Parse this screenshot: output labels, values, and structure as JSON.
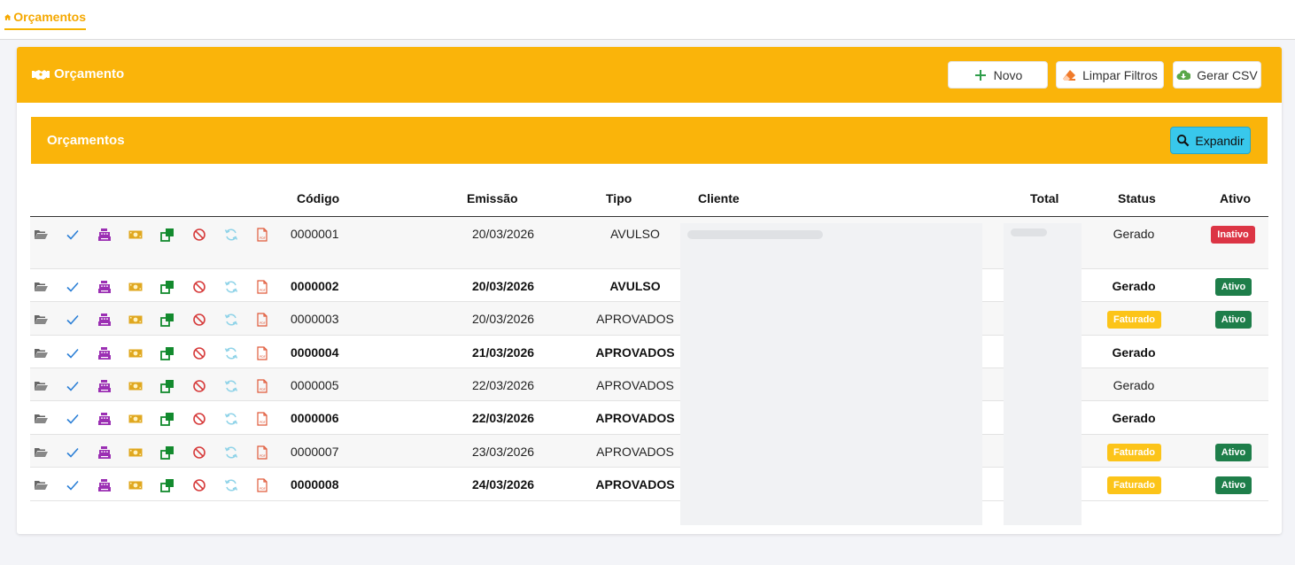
{
  "topbar": {
    "home_label": "Orçamentos"
  },
  "page": {
    "title": "Orçamento",
    "buttons": {
      "novo": "Novo",
      "limpar": "Limpar Filtros",
      "csv": "Gerar CSV"
    }
  },
  "panel": {
    "title": "Orçamentos",
    "expand_label": "Expandir"
  },
  "table": {
    "headers": {
      "codigo": "Código",
      "emissao": "Emissão",
      "tipo": "Tipo",
      "cliente": "Cliente",
      "total": "Total",
      "status": "Status",
      "ativo": "Ativo"
    },
    "rows": [
      {
        "codigo": "0000001",
        "emissao": "20/03/2026",
        "tipo": "AVULSO",
        "status": "Gerado",
        "status_badge": false,
        "ativo": "Inativo",
        "bold": false
      },
      {
        "codigo": "0000002",
        "emissao": "20/03/2026",
        "tipo": "AVULSO",
        "status": "Gerado",
        "status_badge": false,
        "ativo": "Ativo",
        "bold": true
      },
      {
        "codigo": "0000003",
        "emissao": "20/03/2026",
        "tipo": "APROVADOS",
        "status": "Faturado",
        "status_badge": true,
        "ativo": "Ativo",
        "bold": false
      },
      {
        "codigo": "0000004",
        "emissao": "21/03/2026",
        "tipo": "APROVADOS",
        "status": "Gerado",
        "status_badge": false,
        "ativo": "",
        "bold": true
      },
      {
        "codigo": "0000005",
        "emissao": "22/03/2026",
        "tipo": "APROVADOS",
        "status": "Gerado",
        "status_badge": false,
        "ativo": "",
        "bold": false
      },
      {
        "codigo": "0000006",
        "emissao": "22/03/2026",
        "tipo": "APROVADOS",
        "status": "Gerado",
        "status_badge": false,
        "ativo": "",
        "bold": true
      },
      {
        "codigo": "0000007",
        "emissao": "23/03/2026",
        "tipo": "APROVADOS",
        "status": "Faturado",
        "status_badge": true,
        "ativo": "Ativo",
        "bold": false
      },
      {
        "codigo": "0000008",
        "emissao": "24/03/2026",
        "tipo": "APROVADOS",
        "status": "Faturado",
        "status_badge": true,
        "ativo": "Ativo",
        "bold": true
      }
    ],
    "row_actions": [
      "folder-open-icon",
      "check-icon",
      "cash-register-icon",
      "money-bill-icon",
      "copy-icon",
      "cancel-icon",
      "refresh-icon",
      "pdf-icon"
    ]
  },
  "colors": {
    "accent": "#fab40a",
    "expand": "#38c8ec",
    "ativo": "#1e7e4a",
    "inativo": "#dc3545",
    "faturado": "#fcc419"
  }
}
